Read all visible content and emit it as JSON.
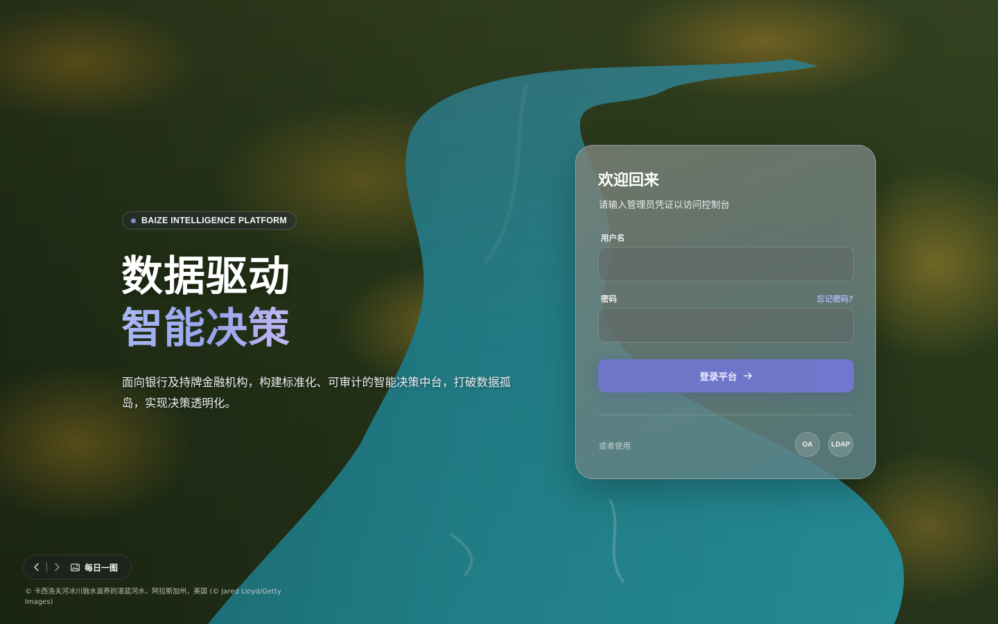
{
  "hero": {
    "badge": "BAIZE INTELLIGENCE PLATFORM",
    "headline_line1": "数据驱动",
    "headline_line2": "智能决策",
    "description": "面向银行及持牌金融机构，构建标准化、可审计的智能决策中台，打破数据孤岛，实现决策透明化。"
  },
  "login": {
    "title": "欢迎回来",
    "subtitle": "请输入管理员凭证以访问控制台",
    "username_label": "用户名",
    "username_value": "",
    "password_label": "密码",
    "password_value": "",
    "forgot_label": "忘记密码?",
    "submit_label": "登录平台",
    "alternative_label": "或者使用",
    "sso_options": [
      "OA",
      "LDAP"
    ]
  },
  "daily_image": {
    "label": "每日一图",
    "caption": "© 卡西洛夫河冰川融水滋养的湛蓝河水，阿拉斯加州，美国 (© Jared Lloyd/Getty Images)"
  },
  "colors": {
    "accent": "#6f77cb",
    "headline_gradient_start": "#a9b7f4",
    "headline_gradient_end": "#c3b7f2",
    "forgot_link": "#aab3ee"
  },
  "icons": {
    "badge": "dot-icon",
    "submit": "arrow-right-icon",
    "prev": "chevron-left-icon",
    "next": "chevron-right-icon",
    "daily": "image-icon"
  }
}
